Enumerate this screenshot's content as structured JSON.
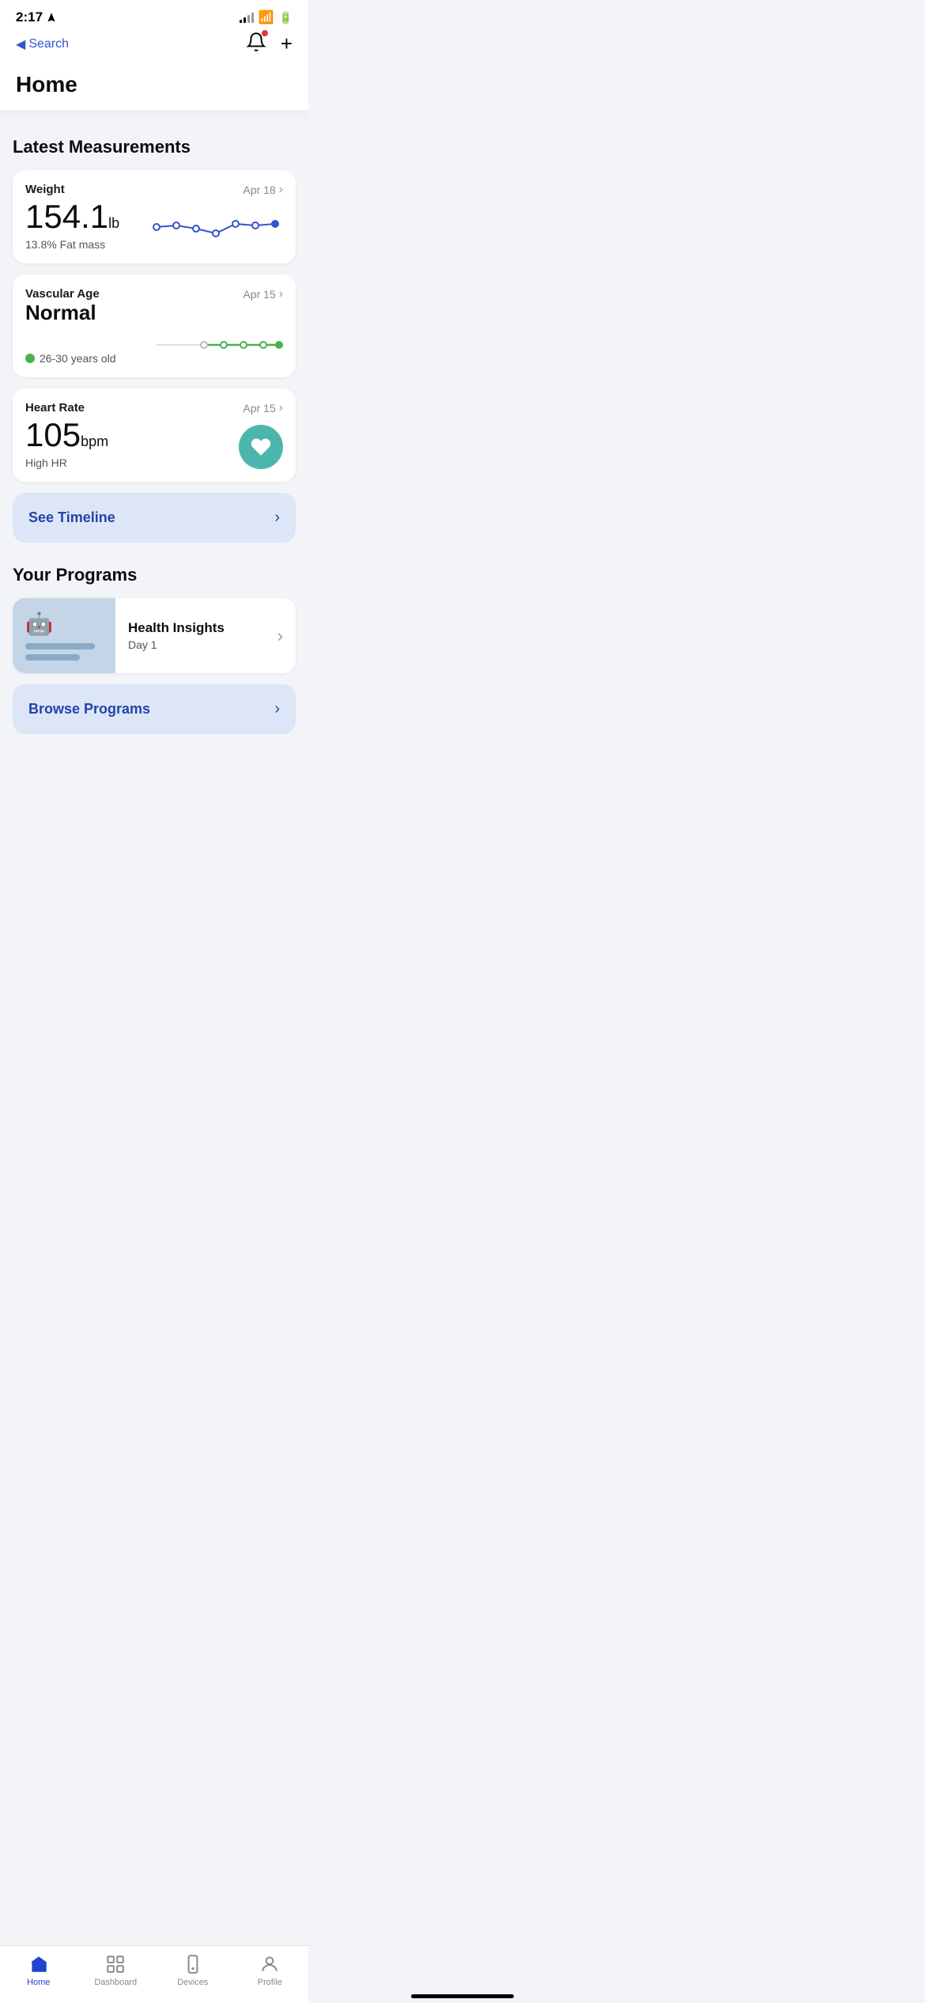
{
  "statusBar": {
    "time": "2:17",
    "hasLocation": true
  },
  "navBar": {
    "backLabel": "Search",
    "title": "Home",
    "hasNotification": true,
    "addLabel": "+"
  },
  "latestMeasurements": {
    "sectionTitle": "Latest Measurements",
    "cards": [
      {
        "title": "Weight",
        "date": "Apr 18",
        "value": "154.1",
        "unit": "lb",
        "sub": "13.8% Fat mass"
      },
      {
        "title": "Vascular Age",
        "statusLabel": "Normal",
        "date": "Apr 15",
        "ageRange": "26-30 years old"
      },
      {
        "title": "Heart Rate",
        "date": "Apr 15",
        "value": "105",
        "unit": "bpm",
        "sub": "High HR"
      }
    ],
    "timelineButton": "See Timeline"
  },
  "programs": {
    "sectionTitle": "Your Programs",
    "programCard": {
      "title": "Health Insights",
      "sub": "Day 1"
    },
    "browseButton": "Browse Programs"
  },
  "tabBar": {
    "items": [
      {
        "label": "Home",
        "active": true
      },
      {
        "label": "Dashboard",
        "active": false
      },
      {
        "label": "Devices",
        "active": false
      },
      {
        "label": "Profile",
        "active": false
      }
    ]
  }
}
